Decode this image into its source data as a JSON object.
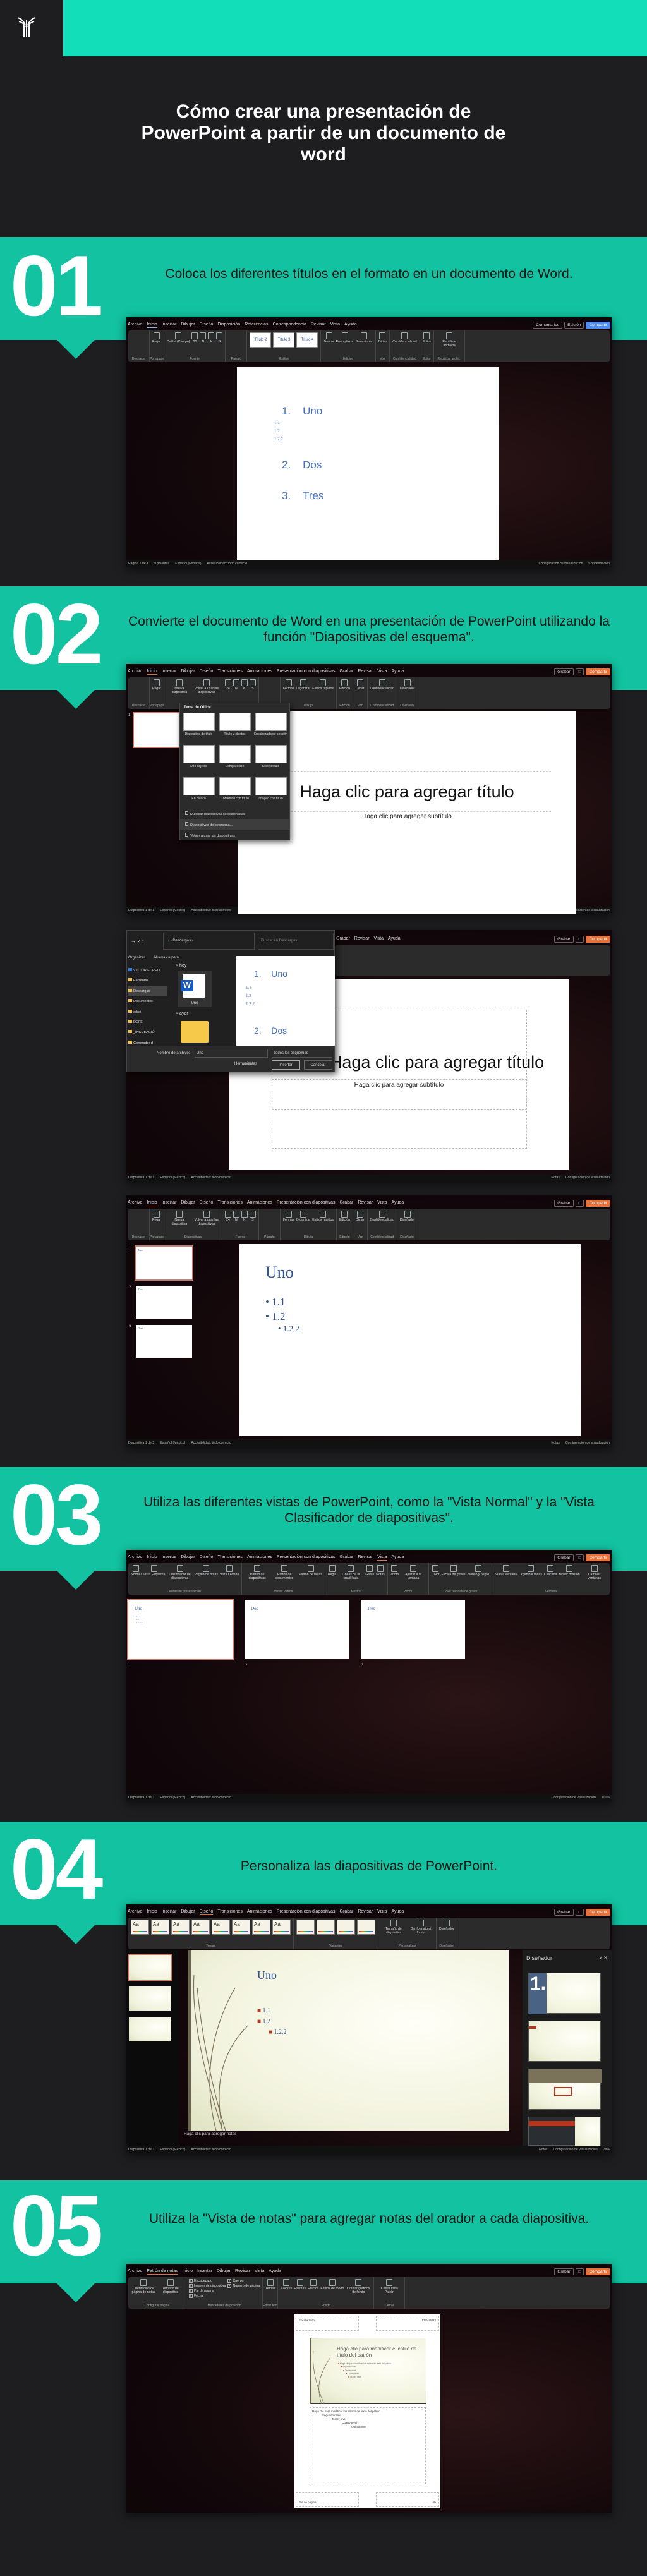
{
  "brand": {
    "logo_icon": "palm-logo",
    "header_color": "#12dfb9",
    "band_color": "#12c2a0",
    "background": "#1e1d20"
  },
  "title": "Cómo crear una presentación de PowerPoint a partir de un documento de word",
  "steps": [
    {
      "number": "01",
      "text": "Coloca los diferentes títulos en el formato en un documento de Word."
    },
    {
      "number": "02",
      "text": "Convierte el documento de Word en una presentación de PowerPoint utilizando la función \"Diapositivas del esquema\"."
    },
    {
      "number": "03",
      "text": "Utiliza las diferentes vistas de PowerPoint, como la \"Vista Normal\" y la \"Vista Clasificador de diapositivas\"."
    },
    {
      "number": "04",
      "text": "Personaliza las diapositivas de PowerPoint."
    },
    {
      "number": "05",
      "text": "Utiliza la \"Vista de notas\" para agregar notas del orador a cada diapositiva."
    }
  ],
  "screens": {
    "word": {
      "tabs": [
        "Archivo",
        "Inicio",
        "Insertar",
        "Dibujar",
        "Diseño",
        "Disposición",
        "Referencias",
        "Correspondencia",
        "Revisar",
        "Vista",
        "Ayuda"
      ],
      "active_tab": 1,
      "right_buttons": [
        "Comentarios",
        "Edición",
        "Compartir"
      ],
      "groups": [
        {
          "label": "Deshacer",
          "items": []
        },
        {
          "label": "Portapapeles",
          "items": [
            "Pegar"
          ]
        },
        {
          "label": "Fuente",
          "items": [
            "Calibri (Cuerpo)",
            "20",
            "N",
            "K",
            "S"
          ]
        },
        {
          "label": "Párrafo",
          "items": []
        },
        {
          "label": "Estilos",
          "gallery": [
            "Título 2",
            "Título 3",
            "Título 4"
          ]
        },
        {
          "label": "Edición",
          "items": [
            "Buscar",
            "Reemplazar",
            "Seleccionar"
          ]
        },
        {
          "label": "Voz",
          "items": [
            "Dictar"
          ]
        },
        {
          "label": "Confidencialidad",
          "items": [
            "Confidencialidad"
          ]
        },
        {
          "label": "Editor",
          "items": [
            "Editor"
          ]
        },
        {
          "label": "Reutilizar archi...",
          "items": [
            "Reutilizar archivos"
          ]
        }
      ],
      "doc": {
        "headings": [
          {
            "num": "1.",
            "text": "Uno"
          },
          {
            "num": "2.",
            "text": "Dos"
          },
          {
            "num": "3.",
            "text": "Tres"
          }
        ],
        "sub": [
          "1.1",
          "1.2",
          "1.2.2"
        ]
      },
      "status_left": [
        "Página 1 de 1",
        "9 palabras",
        "Español (España)",
        "Accesibilidad: todo correcto"
      ],
      "status_right": [
        "Configuración de visualización",
        "Concentración"
      ]
    },
    "ppt_home": {
      "tabs": [
        "Archivo",
        "Inicio",
        "Insertar",
        "Dibujar",
        "Diseño",
        "Transiciones",
        "Animaciones",
        "Presentación con diapositivas",
        "Grabar",
        "Revisar",
        "Vista",
        "Ayuda"
      ],
      "active_tab": 1,
      "right_buttons": [
        "Grabar",
        "Compartir"
      ],
      "groups": [
        {
          "label": "Deshacer",
          "items": []
        },
        {
          "label": "Portapapeles",
          "items": [
            "Pegar"
          ]
        },
        {
          "label": "Diapositivas",
          "items": [
            "Nueva diapositiva",
            "Volver a usar las diapositivas"
          ]
        },
        {
          "label": "Fuente",
          "items": [
            "24",
            "N",
            "K",
            "S"
          ]
        },
        {
          "label": "Párrafo",
          "items": []
        },
        {
          "label": "Dibujo",
          "items": [
            "Formas",
            "Organizar",
            "Estilos rápidos"
          ]
        },
        {
          "label": "Edición",
          "items": [
            "Edición"
          ]
        },
        {
          "label": "Voz",
          "items": [
            "Dictar"
          ]
        },
        {
          "label": "Confidencialidad",
          "items": [
            "Confidencialidad"
          ]
        },
        {
          "label": "Diseñador",
          "items": [
            "Diseñador"
          ]
        }
      ],
      "status_left": [
        "Diapositiva 1 de 1",
        "Español (México)",
        "Accesibilidad: todo correcto"
      ],
      "status_right": [
        "Notas",
        "Configuración de visualización"
      ]
    },
    "new_slide_menu": {
      "header": "Tema de Office",
      "layouts": [
        "Diapositiva de título",
        "Título y objetos",
        "Encabezado de sección",
        "Dos objetos",
        "Comparación",
        "Solo el título",
        "En blanco",
        "Contenido con título",
        "Imagen con título"
      ],
      "actions": [
        "Duplicar diapositivas seleccionadas",
        "Diapositivas del esquema...",
        "Volver a usar las diapositivas"
      ],
      "highlighted_action": 1
    },
    "blank_slide": {
      "number": "1",
      "title": "Haga clic para agregar título",
      "subtitle": "Haga clic para agregar subtítulo"
    },
    "file_dialog": {
      "path": "Descargas",
      "search_placeholder": "Buscar en Descargas",
      "organize": "Organizar",
      "new_folder": "Nueva carpeta",
      "nav": [
        "VICTOR EDREI L",
        "Escritorio",
        "Descargas",
        "Documentos",
        "edrei",
        "DCFE",
        "_INCUBACIÓ",
        "Generador d"
      ],
      "selected_nav": 2,
      "section_today": "hoy",
      "file_name": "Uno",
      "section_yesterday": "ayer",
      "filename_label": "Nombre de archivo:",
      "filename_value": "Uno",
      "filter": "Todos los esquemas",
      "tools": "Herramientas",
      "insert": "Insertar",
      "cancel": "Cancelar"
    },
    "outline_slides": {
      "thumbs": [
        {
          "n": "1",
          "title": "Uno"
        },
        {
          "n": "2",
          "title": "Dos"
        },
        {
          "n": "3",
          "title": "Tres"
        }
      ],
      "main_title": "Uno",
      "bullets": [
        "1.1",
        "1.2"
      ],
      "sub_bullet": "1.2.2",
      "status_left": [
        "Diapositiva 1 de 3",
        "Español (México)",
        "Accesibilidad: todo correcto"
      ]
    },
    "ppt_view": {
      "tabs": [
        "Archivo",
        "Inicio",
        "Insertar",
        "Dibujar",
        "Diseño",
        "Transiciones",
        "Animaciones",
        "Presentación con diapositivas",
        "Grabar",
        "Revisar",
        "Vista",
        "Ayuda"
      ],
      "active_tab": 10,
      "right_buttons": [
        "Grabar",
        "Compartir"
      ],
      "groups": [
        {
          "label": "Vistas de presentación",
          "items": [
            "Normal",
            "Vista Esquema",
            "Clasificador de diapositivas",
            "Página de notas",
            "Vista Lectura"
          ]
        },
        {
          "label": "Vistas Patrón",
          "items": [
            "Patrón de diapositivas",
            "Patrón de documentos",
            "Patrón de notas"
          ]
        },
        {
          "label": "Mostrar",
          "items": [
            "Regla",
            "Líneas de la cuadrícula",
            "Guías",
            "Notas"
          ]
        },
        {
          "label": "Zoom",
          "items": [
            "Zoom",
            "Ajustar a la ventana"
          ]
        },
        {
          "label": "Color o escala de grises",
          "items": [
            "Color",
            "Escala de grises",
            "Blanco y negro"
          ]
        },
        {
          "label": "Ventana",
          "items": [
            "Nueva ventana",
            "Organizar todas",
            "Cascada",
            "Mover división",
            "Cambiar ventanas"
          ]
        },
        {
          "label": "Macros",
          "items": [
            "Macros"
          ]
        }
      ],
      "sorter": [
        {
          "n": "1",
          "title": "Uno",
          "lines": [
            "• 1.1",
            "• 1.2",
            "• 1.2.2"
          ]
        },
        {
          "n": "2",
          "title": "Dos",
          "lines": []
        },
        {
          "n": "3",
          "title": "Tres",
          "lines": []
        }
      ],
      "status_left": [
        "Diapositiva 1 de 3",
        "Español (México)",
        "Accesibilidad: todo correcto"
      ],
      "status_right": [
        "Configuración de visualización",
        "100%"
      ]
    },
    "ppt_design": {
      "tabs": [
        "Archivo",
        "Inicio",
        "Insertar",
        "Dibujar",
        "Diseño",
        "Transiciones",
        "Animaciones",
        "Presentación con diapositivas",
        "Grabar",
        "Revisar",
        "Vista",
        "Ayuda"
      ],
      "active_tab": 4,
      "right_buttons": [
        "Grabar",
        "Compartir"
      ],
      "groups": [
        {
          "label": "Temas",
          "themes": [
            "Aa",
            "Aa",
            "Aa",
            "Aa",
            "Aa",
            "Aa",
            "Aa",
            "Aa"
          ]
        },
        {
          "label": "Variantes",
          "themes": [
            "",
            "",
            "",
            ""
          ]
        },
        {
          "label": "Personalizar",
          "items": [
            "Tamaño de diapositiva",
            "Dar formato al fondo"
          ]
        },
        {
          "label": "Diseñador",
          "items": [
            "Diseñador"
          ]
        }
      ],
      "slide_title": "Uno",
      "bullets": [
        "1.1",
        "1.2"
      ],
      "sub_bullet": "1.2.2",
      "notes_placeholder": "Haga clic para agregar notas",
      "designer_title": "Diseñador",
      "designer_big_number": "1.",
      "status_left": [
        "Diapositiva 1 de 3",
        "Español (México)",
        "Accesibilidad: todo correcto"
      ],
      "status_right": [
        "Notas",
        "Configuración de visualización",
        "78%"
      ]
    },
    "ppt_notes": {
      "tabs": [
        "Archivo",
        "Patrón de notas",
        "Inicio",
        "Insertar",
        "Dibujar",
        "Revisar",
        "Vista",
        "Ayuda"
      ],
      "active_tab": 1,
      "right_buttons": [
        "Grabar",
        "Compartir"
      ],
      "groups": [
        {
          "label": "Configurar página",
          "items": [
            "Orientación de página de notas",
            "Tamaño de diapositiva"
          ]
        },
        {
          "label": "Marcadores de posición",
          "checks": [
            "Encabezado",
            "Imagen de diapositiva",
            "Pie de página",
            "Fecha",
            "Cuerpo",
            "Número de página"
          ]
        },
        {
          "label": "Editar tema",
          "items": [
            "Temas"
          ]
        },
        {
          "label": "Fondo",
          "items": [
            "Colores",
            "Fuentes",
            "Efectos",
            "Estilos de fondo",
            "Ocultar gráficos de fondo"
          ]
        },
        {
          "label": "Cerrar",
          "items": [
            "Cerrar vista Patrón"
          ]
        }
      ],
      "header": "Encabezado",
      "date": "13/04/2023",
      "master_title": "Haga clic para modificar el estilo de título del patrón",
      "master_levels": [
        "Haga clic para modificar los estilos de texto del patrón",
        "Segundo nivel",
        "Tercer nivel",
        "Cuarto nivel",
        "Quinto nivel"
      ],
      "body_levels": [
        "Haga clic para modificar los estilos de texto del patrón",
        "Segundo nivel",
        "Tercer nivel",
        "Cuarto nivel",
        "Quinto nivel"
      ],
      "footer": "Pie de página",
      "page_number": "‹#›"
    }
  }
}
